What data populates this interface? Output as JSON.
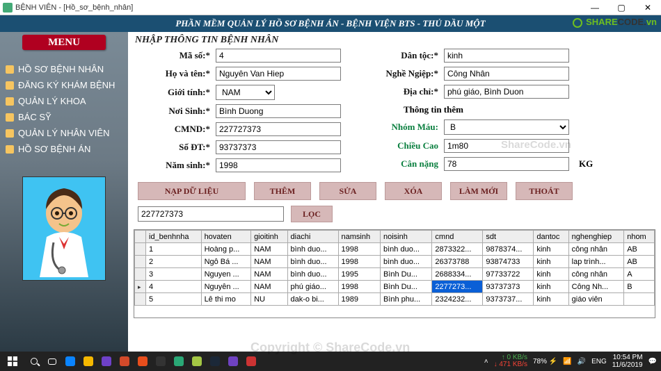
{
  "window": {
    "title": "BỆNH VIÊN - [Hồ_sơ_bệnh_nhân]"
  },
  "app_title": "PHẦN MỀM QUẢN LÝ HỒ SƠ BỆNH ÁN - BỆNH VIỆN BTS - THỦ DẦU MỘT",
  "sharecode": {
    "share": "SHARE",
    "code": "CODE",
    "tld": "vn",
    "watermark_mid": "ShareCode.vn",
    "watermark_bot": "Copyright © ShareCode.vn"
  },
  "menu": {
    "header": "MENU",
    "items": [
      "HỒ SƠ BỆNH NHÂN",
      "ĐĂNG KÝ KHÁM BỆNH",
      "QUẢN LÝ KHOA",
      "BÁC SỸ",
      "QUẢN LÝ NHÂN VIÊN",
      "HỒ SƠ BỆNH ÁN"
    ]
  },
  "section_title": "NHẬP THÔNG TIN BỆNH NHÂN",
  "labels": {
    "ma_so": "Mã số:*",
    "ho_ten": "Họ và tên:*",
    "gioi_tinh": "Giới tính:*",
    "noi_sinh": "Nơi Sinh:*",
    "cmnd": "CMND:*",
    "so_dt": "Số ĐT:*",
    "nam_sinh": "Năm sinh:*",
    "dan_toc": "Dân tộc:*",
    "nghe_nghiep": "Nghề Ngiệp:*",
    "dia_chi": "Địa chỉ:*",
    "thong_tin_them": "Thông tin thêm",
    "nhom_mau": "Nhóm Máu:",
    "chieu_cao": "Chiều Cao",
    "can_nang": "Cân nặng",
    "kg": "KG"
  },
  "values": {
    "ma_so": "4",
    "ho_ten": "Nguyên Van Hiep",
    "gioi_tinh": "NAM",
    "noi_sinh": "Bình Duong",
    "cmnd": "227727373",
    "so_dt": "93737373",
    "nam_sinh": "1998",
    "dan_toc": "kinh",
    "nghe_nghiep": "Công Nhân",
    "dia_chi": "phú giáo, Bình Duon",
    "nhom_mau": "B",
    "chieu_cao": "1m80",
    "can_nang": "78"
  },
  "buttons": {
    "nap": "NẠP DỮ LIỆU",
    "them": "THÊM",
    "sua": "SỬA",
    "xoa": "XÓA",
    "lam_moi": "LÀM MỚI",
    "thoat": "THOÁT",
    "loc": "LỌC"
  },
  "filter_value": "227727373",
  "grid": {
    "columns": [
      "id_benhnha",
      "hovaten",
      "gioitinh",
      "diachi",
      "namsinh",
      "noisinh",
      "cmnd",
      "sdt",
      "dantoc",
      "nghenghiep",
      "nhom"
    ],
    "rows": [
      [
        "1",
        "Hoàng p...",
        "NAM",
        "bình duo...",
        "1998",
        "bình duo...",
        "2873322...",
        "9878374...",
        "kinh",
        "công nhân",
        "AB"
      ],
      [
        "2",
        "Ngô Bá ...",
        "NAM",
        "bình duo...",
        "1998",
        "bình duo...",
        "26373788",
        "93874733",
        "kinh",
        "lap trình...",
        "AB"
      ],
      [
        "3",
        "Nguyen ...",
        "NAM",
        "bình duo...",
        "1995",
        "Bình Du...",
        "2688334...",
        "97733722",
        "kinh",
        "công nhân",
        "A"
      ],
      [
        "4",
        "Nguyên ...",
        "NAM",
        "phú giáo...",
        "1998",
        "Bình Du...",
        "2277273...",
        "93737373",
        "kinh",
        "Công Nh...",
        "B"
      ],
      [
        "5",
        "Lê thi mo",
        "NU",
        "dak-o bi...",
        "1989",
        "Bình phu...",
        "2324232...",
        "9373737...",
        "kinh",
        "giáo viên",
        ""
      ]
    ],
    "selected_row": 3,
    "selected_col": 6
  },
  "taskbar": {
    "net_up": "0 KB/s",
    "net_down": "471 KB/s",
    "battery": "78%",
    "lang": "ENG",
    "time": "10:54 PM",
    "date": "11/6/2019"
  }
}
